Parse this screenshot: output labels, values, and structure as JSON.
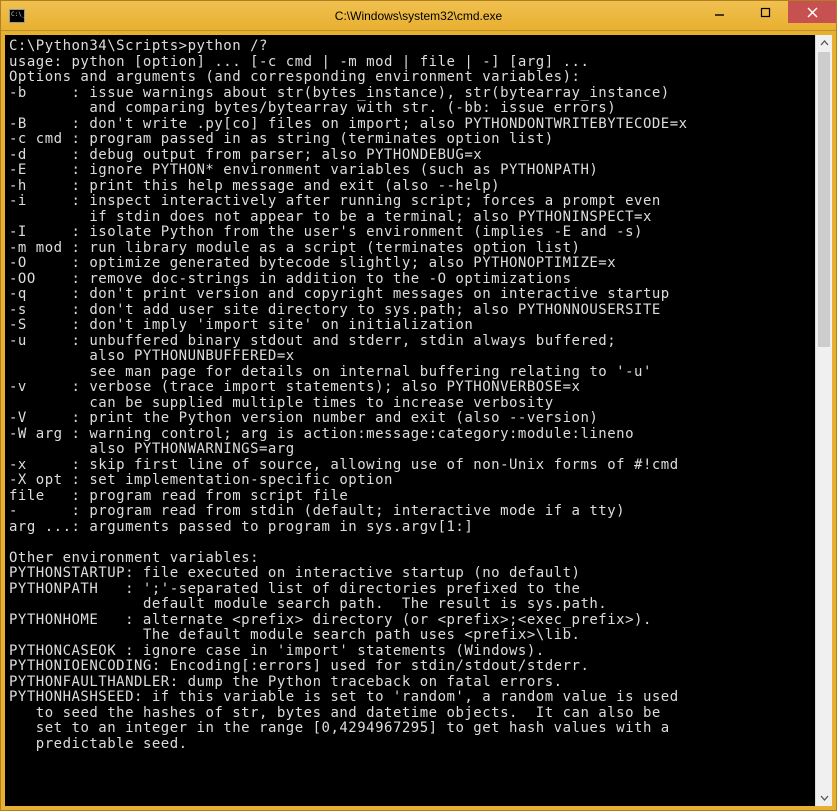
{
  "titlebar": {
    "title": "C:\\Windows\\system32\\cmd.exe"
  },
  "console": {
    "text": "C:\\Python34\\Scripts>python /?\nusage: python [option] ... [-c cmd | -m mod | file | -] [arg] ...\nOptions and arguments (and corresponding environment variables):\n-b     : issue warnings about str(bytes_instance), str(bytearray_instance)\n         and comparing bytes/bytearray with str. (-bb: issue errors)\n-B     : don't write .py[co] files on import; also PYTHONDONTWRITEBYTECODE=x\n-c cmd : program passed in as string (terminates option list)\n-d     : debug output from parser; also PYTHONDEBUG=x\n-E     : ignore PYTHON* environment variables (such as PYTHONPATH)\n-h     : print this help message and exit (also --help)\n-i     : inspect interactively after running script; forces a prompt even\n         if stdin does not appear to be a terminal; also PYTHONINSPECT=x\n-I     : isolate Python from the user's environment (implies -E and -s)\n-m mod : run library module as a script (terminates option list)\n-O     : optimize generated bytecode slightly; also PYTHONOPTIMIZE=x\n-OO    : remove doc-strings in addition to the -O optimizations\n-q     : don't print version and copyright messages on interactive startup\n-s     : don't add user site directory to sys.path; also PYTHONNOUSERSITE\n-S     : don't imply 'import site' on initialization\n-u     : unbuffered binary stdout and stderr, stdin always buffered;\n         also PYTHONUNBUFFERED=x\n         see man page for details on internal buffering relating to '-u'\n-v     : verbose (trace import statements); also PYTHONVERBOSE=x\n         can be supplied multiple times to increase verbosity\n-V     : print the Python version number and exit (also --version)\n-W arg : warning control; arg is action:message:category:module:lineno\n         also PYTHONWARNINGS=arg\n-x     : skip first line of source, allowing use of non-Unix forms of #!cmd\n-X opt : set implementation-specific option\nfile   : program read from script file\n-      : program read from stdin (default; interactive mode if a tty)\narg ...: arguments passed to program in sys.argv[1:]\n\nOther environment variables:\nPYTHONSTARTUP: file executed on interactive startup (no default)\nPYTHONPATH   : ';'-separated list of directories prefixed to the\n               default module search path.  The result is sys.path.\nPYTHONHOME   : alternate <prefix> directory (or <prefix>;<exec_prefix>).\n               The default module search path uses <prefix>\\lib.\nPYTHONCASEOK : ignore case in 'import' statements (Windows).\nPYTHONIOENCODING: Encoding[:errors] used for stdin/stdout/stderr.\nPYTHONFAULTHANDLER: dump the Python traceback on fatal errors.\nPYTHONHASHSEED: if this variable is set to 'random', a random value is used\n   to seed the hashes of str, bytes and datetime objects.  It can also be\n   set to an integer in the range [0,4294967295] to get hash values with a\n   predictable seed."
  }
}
